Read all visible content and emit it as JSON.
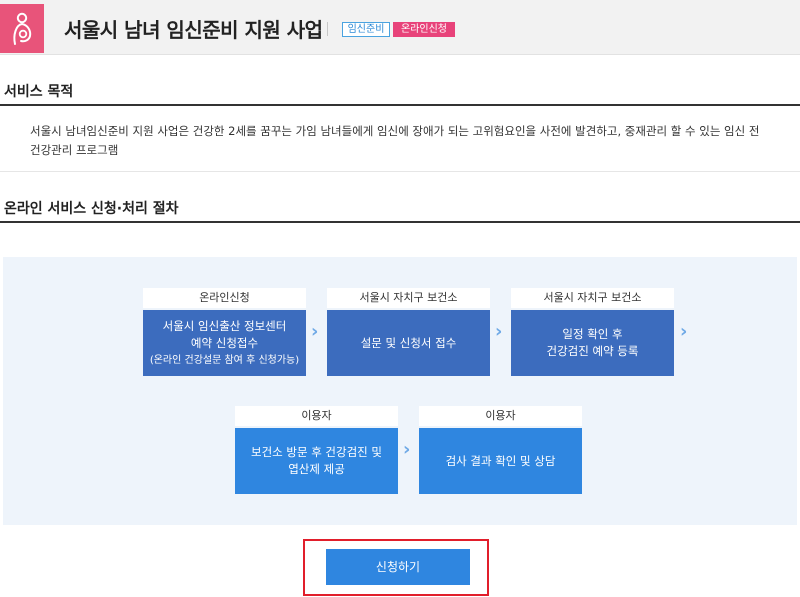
{
  "header": {
    "title": "서울시 남녀 임신준비 지원 사업",
    "badges": [
      "임신준비",
      "온라인신청"
    ],
    "logo_icon": "pregnant-woman-icon"
  },
  "purpose": {
    "heading": "서비스 목적",
    "description": "서울시 남녀임신준비 지원 사업은 건강한 2세를 꿈꾸는 가임 남녀들에게 임신에 장애가 되는 고위험요인을 사전에 발견하고, 중재관리 할 수 있는 임신 전 건강관리 프로그램"
  },
  "process": {
    "heading": "온라인 서비스 신청·처리 절차",
    "steps": [
      {
        "label": "온라인신청",
        "line1": "서울시 임신출산 정보센터",
        "line2": "예약 신청접수",
        "line3": "(온라인 건강설문 참여 후 신청가능)"
      },
      {
        "label": "서울시 자치구 보건소",
        "line1": "설문 및 신청서 접수"
      },
      {
        "label": "서울시 자치구 보건소",
        "line1": "일정 확인 후",
        "line2": "건강검진 예약 등록"
      },
      {
        "label": "이용자",
        "line1": "보건소 방문 후 건강검진 및",
        "line2": "엽산제 제공"
      },
      {
        "label": "이용자",
        "line1": "검사 결과 확인 및 상담"
      }
    ]
  },
  "apply_button": "신청하기",
  "colors": {
    "brand_pink": "#e8547a",
    "step_dark": "#3c6cbe",
    "step_light": "#2f86e0",
    "highlight_red": "#e11e2b"
  }
}
